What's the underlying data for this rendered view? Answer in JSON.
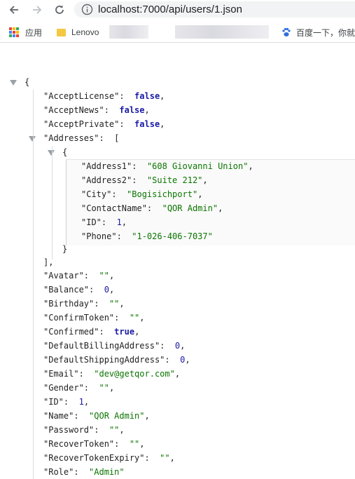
{
  "browser": {
    "url": "localhost:7000/api/users/1.json",
    "bookmarks": {
      "apps_label": "应用",
      "lenovo_label": "Lenovo",
      "baidu_label": "百度一下，你就"
    }
  },
  "json": {
    "open_brace": "{",
    "close_brace": "}",
    "accept_license": {
      "key": "\"AcceptLicense\":",
      "value": "false",
      "sep": ","
    },
    "accept_news": {
      "key": "\"AcceptNews\":",
      "value": "false",
      "sep": ","
    },
    "accept_private": {
      "key": "\"AcceptPrivate\":",
      "value": "false",
      "sep": ","
    },
    "addresses": {
      "key": "\"Addresses\":",
      "open": "[",
      "close": "],",
      "item_open": "{",
      "item_close": "}"
    },
    "address1": {
      "key": "\"Address1\":",
      "value": "\"608 Giovanni Union\"",
      "sep": ","
    },
    "address2": {
      "key": "\"Address2\":",
      "value": "\"Suite 212\"",
      "sep": ","
    },
    "city": {
      "key": "\"City\":",
      "value": "\"Bogisichport\"",
      "sep": ","
    },
    "contact_name": {
      "key": "\"ContactName\":",
      "value": "\"QOR Admin\"",
      "sep": ","
    },
    "addr_id": {
      "key": "\"ID\":",
      "value": "1",
      "sep": ","
    },
    "phone": {
      "key": "\"Phone\":",
      "value": "\"1-026-406-7037\"",
      "sep": ""
    },
    "avatar": {
      "key": "\"Avatar\":",
      "value": "\"\"",
      "sep": ","
    },
    "balance": {
      "key": "\"Balance\":",
      "value": "0",
      "sep": ","
    },
    "birthday": {
      "key": "\"Birthday\":",
      "value": "\"\"",
      "sep": ","
    },
    "confirm_token": {
      "key": "\"ConfirmToken\":",
      "value": "\"\"",
      "sep": ","
    },
    "confirmed": {
      "key": "\"Confirmed\":",
      "value": "true",
      "sep": ","
    },
    "default_billing": {
      "key": "\"DefaultBillingAddress\":",
      "value": "0",
      "sep": ","
    },
    "default_shipping": {
      "key": "\"DefaultShippingAddress\":",
      "value": "0",
      "sep": ","
    },
    "email": {
      "key": "\"Email\":",
      "value": "\"dev@getqor.com\"",
      "sep": ","
    },
    "gender": {
      "key": "\"Gender\":",
      "value": "\"\"",
      "sep": ","
    },
    "id": {
      "key": "\"ID\":",
      "value": "1",
      "sep": ","
    },
    "name": {
      "key": "\"Name\":",
      "value": "\"QOR Admin\"",
      "sep": ","
    },
    "password": {
      "key": "\"Password\":",
      "value": "\"\"",
      "sep": ","
    },
    "recover_token": {
      "key": "\"RecoverToken\":",
      "value": "\"\"",
      "sep": ","
    },
    "recover_token_expiry": {
      "key": "\"RecoverTokenExpiry\":",
      "value": "\"\"",
      "sep": ","
    },
    "role": {
      "key": "\"Role\":",
      "value": "\"Admin\"",
      "sep": ""
    }
  },
  "colors": {
    "string": "#0b7500",
    "literal": "#1a1aa6",
    "key": "#222222"
  }
}
